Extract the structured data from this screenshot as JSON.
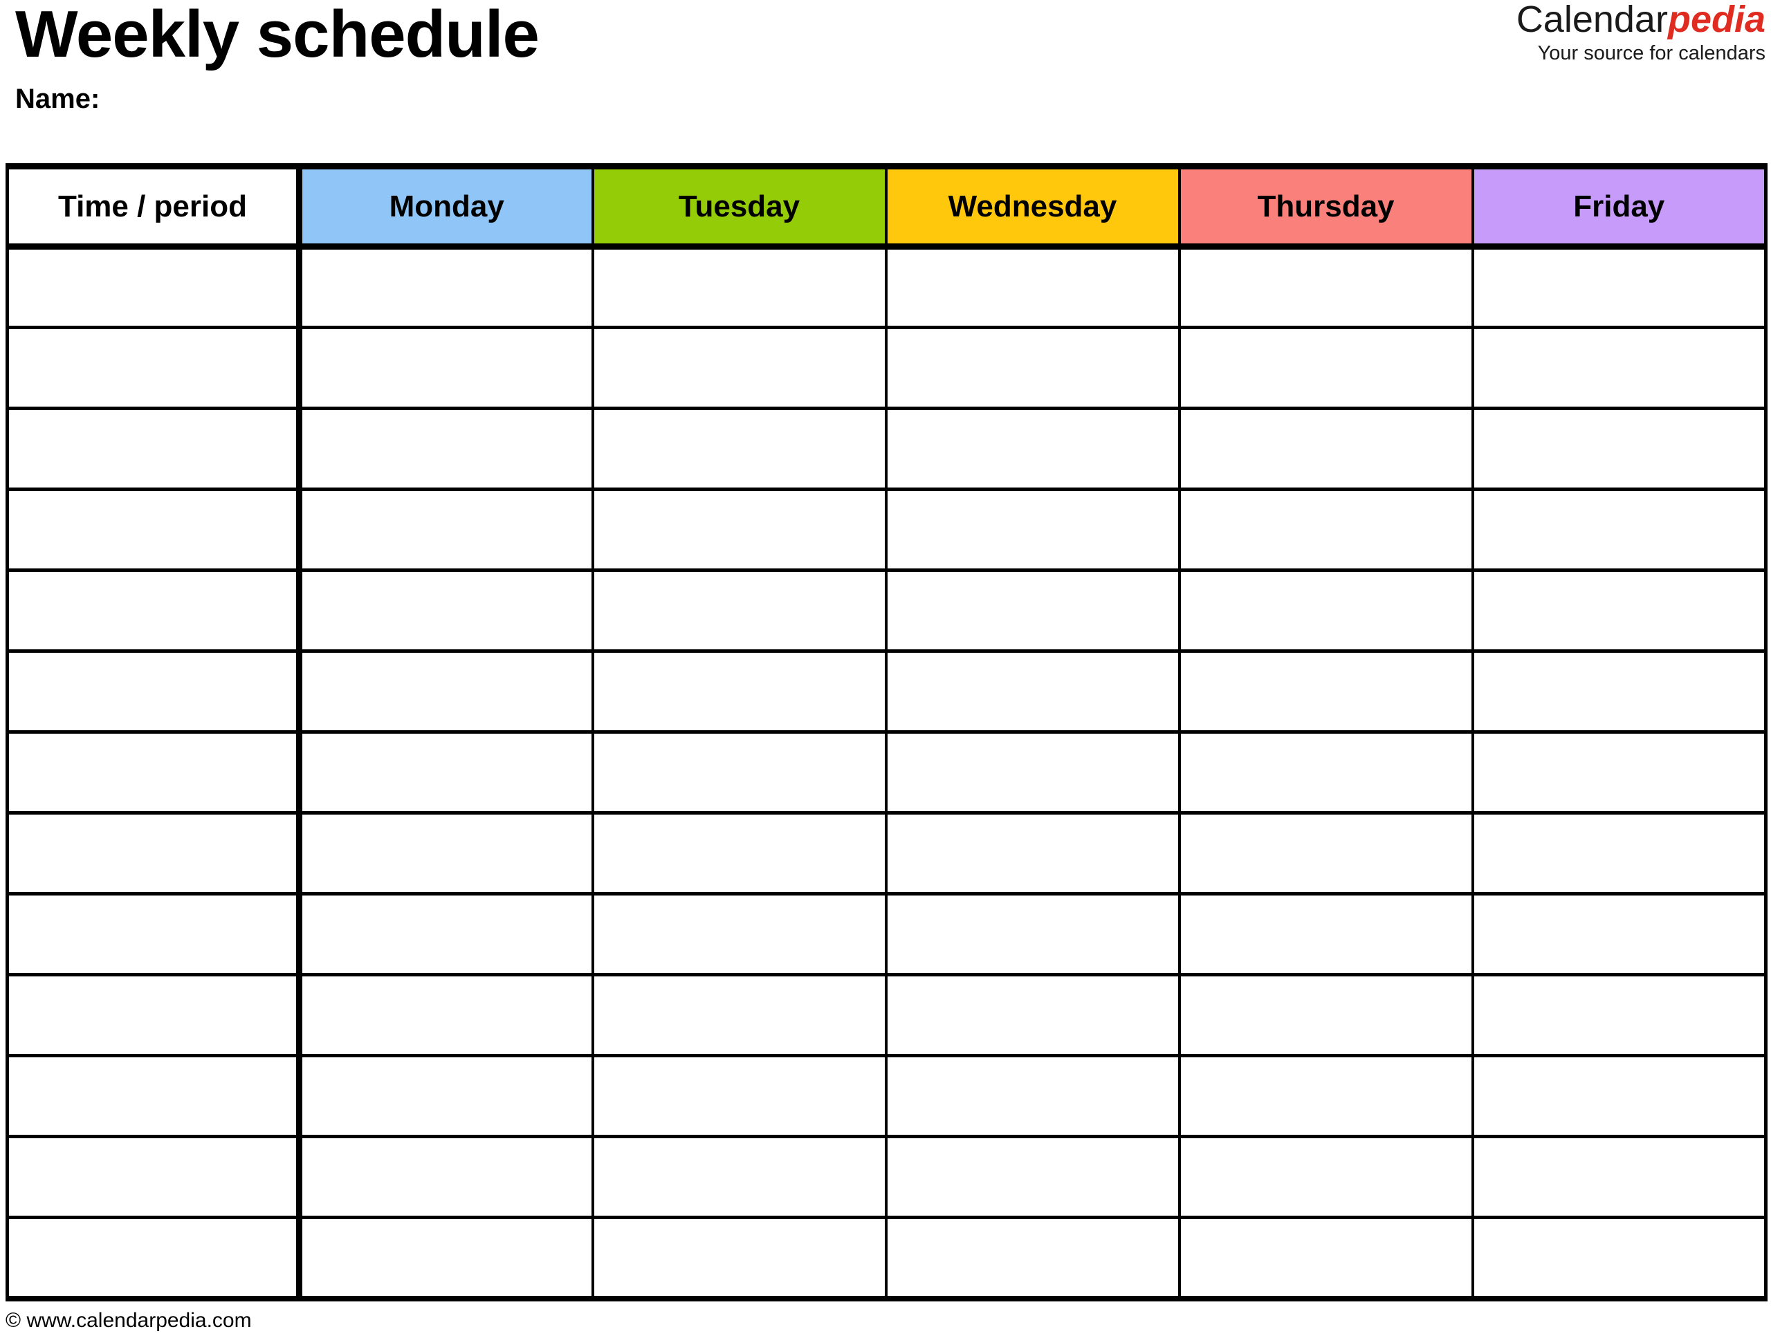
{
  "document": {
    "title": "Weekly schedule",
    "name_label": "Name:"
  },
  "brand": {
    "word_black": "Calendar",
    "word_red": "pedia",
    "tagline": "Your source for calendars",
    "accent_color": "#E02B20"
  },
  "table": {
    "columns": [
      {
        "label": "Time / period",
        "bg": "#ffffff",
        "key": "time"
      },
      {
        "label": "Monday",
        "bg": "#8FC5F7",
        "key": "monday"
      },
      {
        "label": "Tuesday",
        "bg": "#95CC08",
        "key": "tuesday"
      },
      {
        "label": "Wednesday",
        "bg": "#FFC80D",
        "key": "wednesday"
      },
      {
        "label": "Thursday",
        "bg": "#FA807C",
        "key": "thursday"
      },
      {
        "label": "Friday",
        "bg": "#C79BFA",
        "key": "friday"
      }
    ],
    "row_count": 13,
    "rows": [
      {
        "time": "",
        "monday": "",
        "tuesday": "",
        "wednesday": "",
        "thursday": "",
        "friday": ""
      },
      {
        "time": "",
        "monday": "",
        "tuesday": "",
        "wednesday": "",
        "thursday": "",
        "friday": ""
      },
      {
        "time": "",
        "monday": "",
        "tuesday": "",
        "wednesday": "",
        "thursday": "",
        "friday": ""
      },
      {
        "time": "",
        "monday": "",
        "tuesday": "",
        "wednesday": "",
        "thursday": "",
        "friday": ""
      },
      {
        "time": "",
        "monday": "",
        "tuesday": "",
        "wednesday": "",
        "thursday": "",
        "friday": ""
      },
      {
        "time": "",
        "monday": "",
        "tuesday": "",
        "wednesday": "",
        "thursday": "",
        "friday": ""
      },
      {
        "time": "",
        "monday": "",
        "tuesday": "",
        "wednesday": "",
        "thursday": "",
        "friday": ""
      },
      {
        "time": "",
        "monday": "",
        "tuesday": "",
        "wednesday": "",
        "thursday": "",
        "friday": ""
      },
      {
        "time": "",
        "monday": "",
        "tuesday": "",
        "wednesday": "",
        "thursday": "",
        "friday": ""
      },
      {
        "time": "",
        "monday": "",
        "tuesday": "",
        "wednesday": "",
        "thursday": "",
        "friday": ""
      },
      {
        "time": "",
        "monday": "",
        "tuesday": "",
        "wednesday": "",
        "thursday": "",
        "friday": ""
      },
      {
        "time": "",
        "monday": "",
        "tuesday": "",
        "wednesday": "",
        "thursday": "",
        "friday": ""
      },
      {
        "time": "",
        "monday": "",
        "tuesday": "",
        "wednesday": "",
        "thursday": "",
        "friday": ""
      }
    ]
  },
  "footer": {
    "copyright": "© www.calendarpedia.com"
  }
}
